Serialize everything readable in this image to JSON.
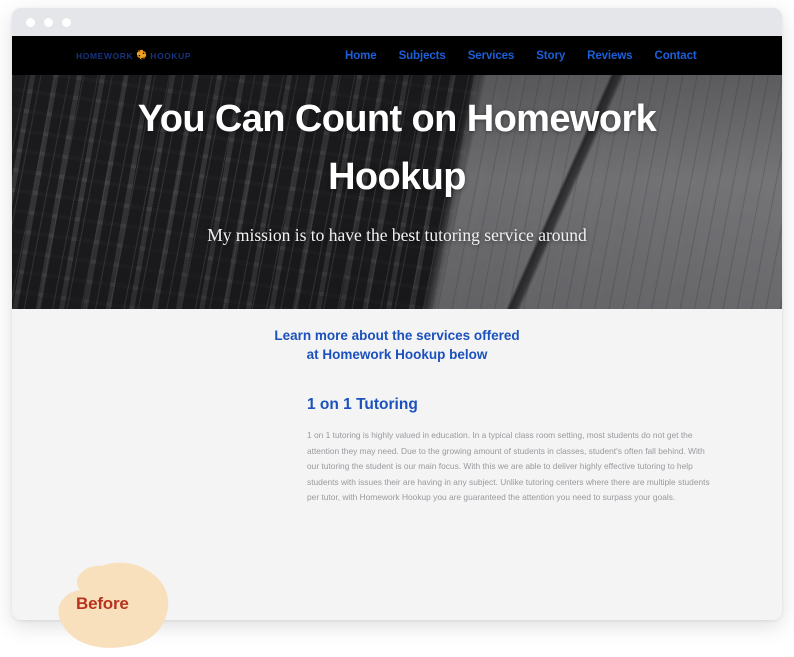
{
  "browser": {
    "traffic_lights": [
      "dot-red",
      "dot-yellow",
      "dot-green"
    ]
  },
  "site": {
    "logo": {
      "text_left": "HOMEWORK",
      "text_right": "HOOKUP",
      "icon": "puzzle-piece-icon",
      "text_color": "#16347f",
      "icon_color": "#f0a020"
    },
    "nav": {
      "items": [
        {
          "label": "Home"
        },
        {
          "label": "Subjects"
        },
        {
          "label": "Services"
        },
        {
          "label": "Story"
        },
        {
          "label": "Reviews"
        },
        {
          "label": "Contact"
        }
      ],
      "link_color": "#1b5fd9",
      "background": "#000000"
    },
    "hero": {
      "title": "You Can Count on Homework Hookup",
      "subtitle": "My mission is to have the best tutoring service around",
      "background_image": "grayscale-laptop-keyboard-notebook-pen-photo"
    },
    "content": {
      "lead_line_1": "Learn more about the services offered",
      "lead_line_2": "at Homework Hookup below",
      "lead_color": "#1b51bd",
      "service": {
        "title": "1 on 1 Tutoring",
        "body": "1 on 1 tutoring is highly valued in education. In a typical class room setting, most students do not get the attention they may need. Due to the growing amount of students in classes, student's often fall behind. With our tutoring the student is our main focus. With this we are able to deliver highly effective tutoring to help students with issues their are having in any subject. Unlike tutoring centers where there are multiple students per tutor, with Homework Hookup you are guaranteed the attention you need to surpass your goals."
      },
      "background": "#f4f4f5"
    }
  },
  "annotation": {
    "badge_label": "Before",
    "badge_fill": "#f8e0bc",
    "badge_text_color": "#b8341f"
  }
}
